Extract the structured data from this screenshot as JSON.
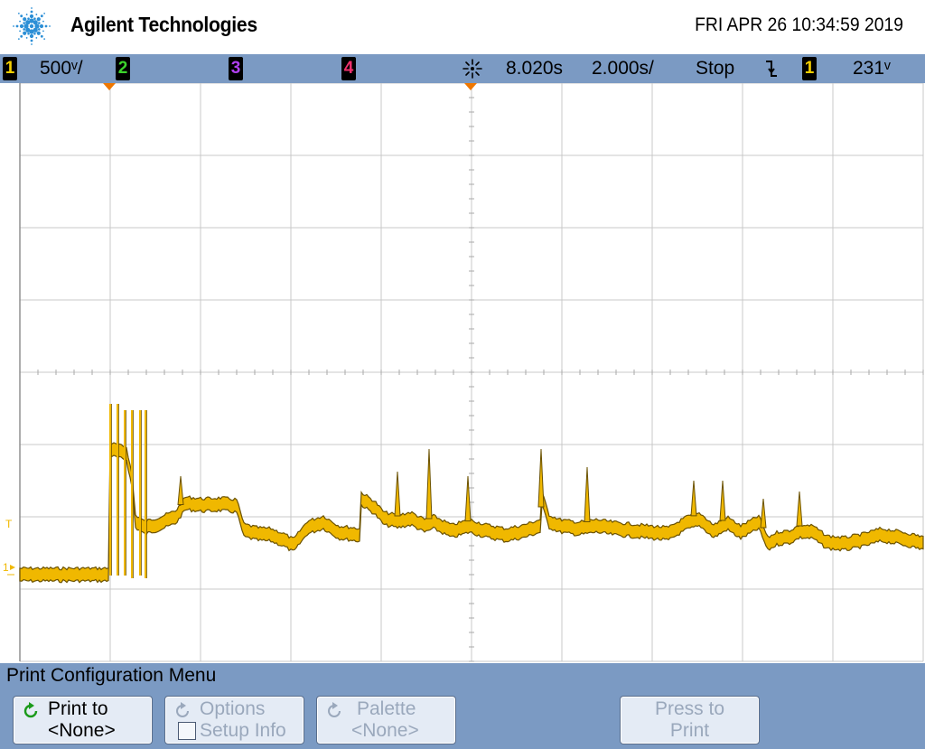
{
  "header": {
    "brand": "Agilent Technologies",
    "datetime": "FRI APR 26 10:34:59 2019"
  },
  "status_bar": {
    "ch1_label": "1",
    "ch1_scale": "500ᵛ/",
    "ch2_label": "2",
    "ch3_label": "3",
    "ch4_label": "4",
    "time_delay": "8.020s",
    "time_scale": "2.000s/",
    "run_state": "Stop",
    "trigger_slope_icon": "falling-edge-icon",
    "trigger_source": "1",
    "trigger_level": "231ᵛ",
    "colors": {
      "ch1": "#f6d000",
      "ch2": "#3cd42c",
      "ch3": "#b040f0",
      "ch4": "#f0306e",
      "bar": "#7b9ac3"
    }
  },
  "display": {
    "trigger_marker_label": "T",
    "ground_marker_label": "1",
    "trace_color": "#f0b800",
    "trace_edge_color": "#6b5200"
  },
  "menu": {
    "title": "Print Configuration Menu",
    "softkeys": [
      {
        "line1": "Print to",
        "line2": "<None>",
        "enabled": true
      },
      {
        "line1": "Options",
        "line2": "Setup Info",
        "enabled": false
      },
      {
        "line1": "Palette",
        "line2": "<None>",
        "enabled": false
      },
      {
        "line1": "Press to",
        "line2": "Print",
        "enabled": false
      }
    ]
  }
}
